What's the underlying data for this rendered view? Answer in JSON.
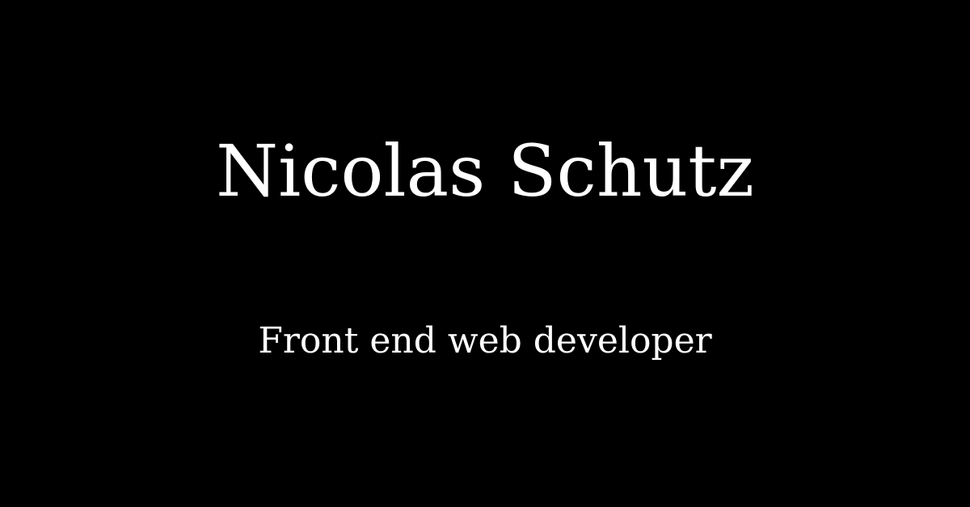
{
  "colors": {
    "background": "#000000",
    "text": "#ffffff"
  },
  "card": {
    "name": "Nicolas Schutz",
    "tagline": "Front end web developer"
  }
}
